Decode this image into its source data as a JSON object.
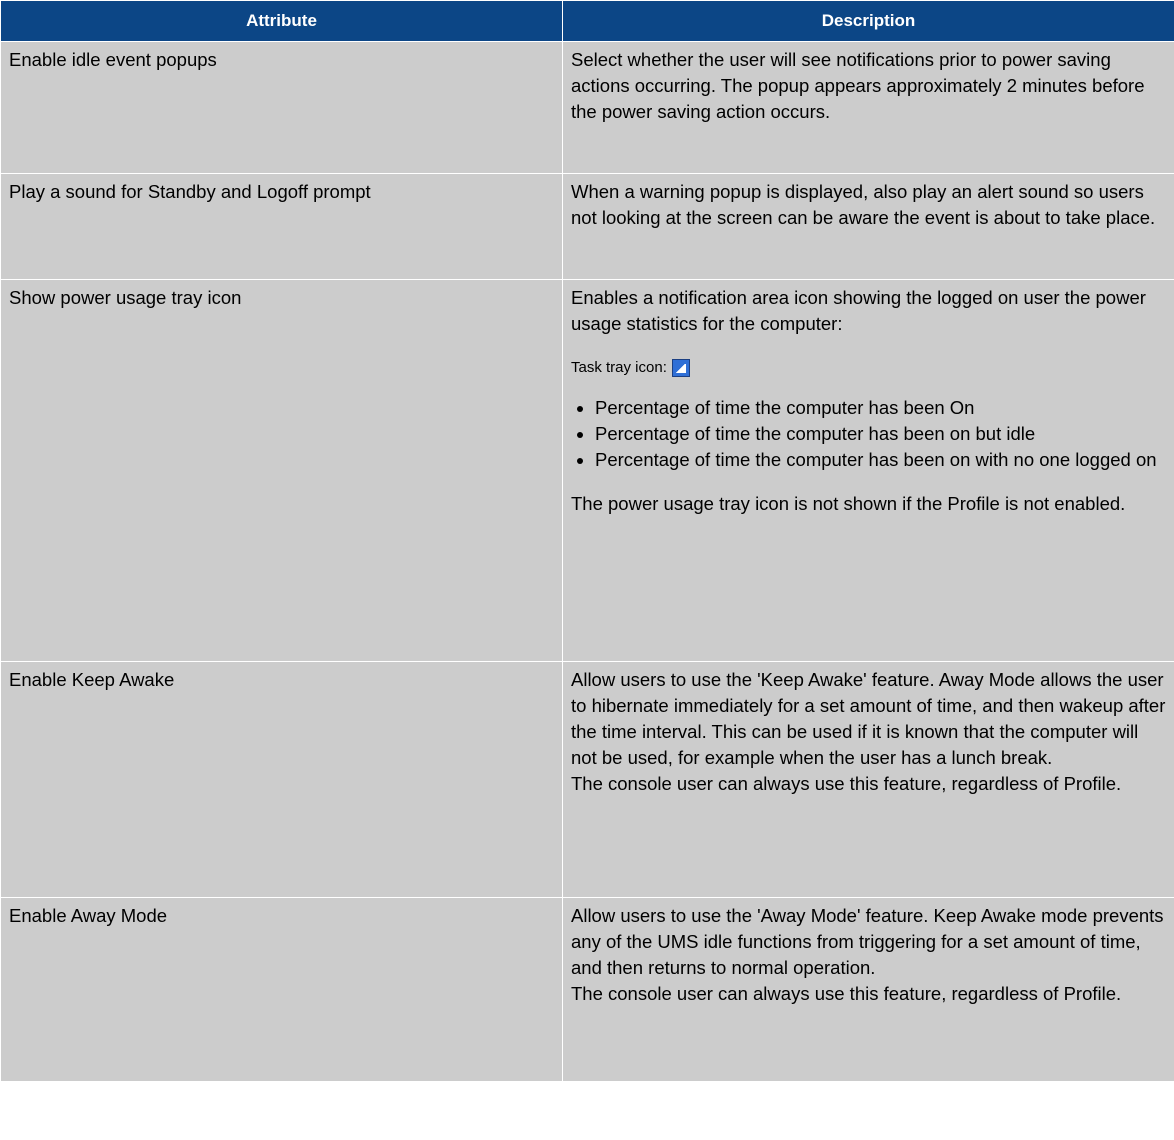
{
  "table": {
    "headers": {
      "attribute": "Attribute",
      "description": "Description"
    },
    "rows": [
      {
        "attribute": "Enable idle event popups",
        "description": "Select whether the user will see notifications prior to power saving actions occurring. The popup appears approximately 2 minutes before the power saving action occurs."
      },
      {
        "attribute": "Play a sound for Standby and Logoff prompt",
        "description": "When a warning popup is displayed, also play an alert sound so users not looking at the screen can be aware the event is about to take place."
      },
      {
        "attribute": "Show power usage tray icon",
        "intro": "Enables a notification area icon showing the logged on user the power usage statistics for the computer:",
        "icon_label": "Task tray icon:",
        "icon": "power-usage-tray-icon",
        "bullets": [
          "Percentage of time the computer has been On",
          "Percentage of time the computer has been on but idle",
          "Percentage of time the computer has been on with no one logged on"
        ],
        "note": "The power usage tray icon is not shown if the Profile is not enabled."
      },
      {
        "attribute": "Enable Keep Awake",
        "description": "Allow users to use the 'Keep Awake' feature.  Away Mode allows the user to hibernate immediately for a set amount of time, and then wakeup after the time interval.  This can be used if it is known that the computer will not be used, for example when the user has a lunch break.",
        "note": "The console user can always use this feature, regardless of Profile."
      },
      {
        "attribute": "Enable Away Mode",
        "description": "Allow users to use the 'Away Mode' feature.  Keep Awake mode prevents any of the UMS idle functions from triggering for a set amount of time, and then returns to normal operation.",
        "note": "The console user can always use this feature, regardless of Profile."
      }
    ]
  },
  "colors": {
    "header_bg": "#0c4686",
    "header_text": "#ffffff",
    "cell_bg": "#cccccc",
    "border": "#ffffff"
  }
}
